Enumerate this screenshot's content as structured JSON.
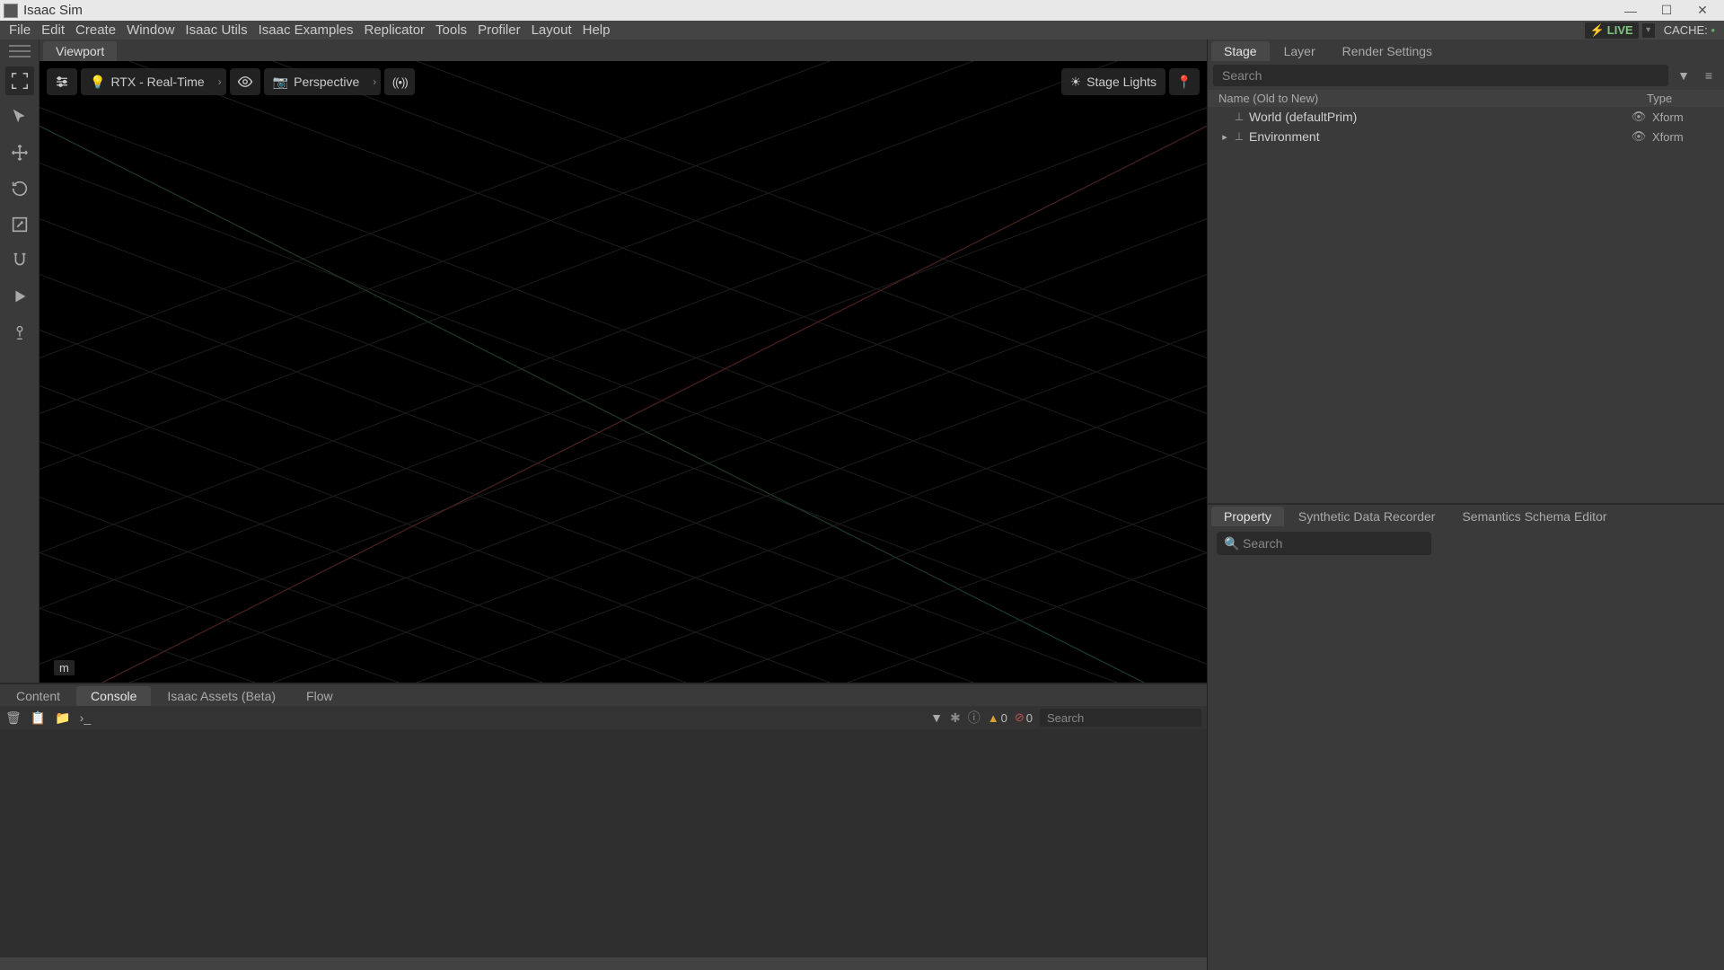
{
  "app_title": "Isaac Sim",
  "menus": [
    "File",
    "Edit",
    "Create",
    "Window",
    "Isaac Utils",
    "Isaac Examples",
    "Replicator",
    "Tools",
    "Profiler",
    "Layout",
    "Help"
  ],
  "live_label": "LIVE",
  "cache_label": "CACHE:",
  "viewport": {
    "tab": "Viewport",
    "render_mode": "RTX - Real-Time",
    "camera_label": "Perspective",
    "right_label": "Stage Lights",
    "corner_unit": "m"
  },
  "bottom_tabs": [
    "Content",
    "Console",
    "Isaac Assets (Beta)",
    "Flow"
  ],
  "bottom_active": 1,
  "console": {
    "warn_count": "0",
    "err_count": "0",
    "search_placeholder": "Search"
  },
  "right_top_tabs": [
    "Stage",
    "Layer",
    "Render Settings"
  ],
  "stage": {
    "search_placeholder": "Search",
    "header_name": "Name (Old to New)",
    "header_type": "Type",
    "rows": [
      {
        "expander": "",
        "label": "World (defaultPrim)",
        "type": "Xform",
        "indent": 0
      },
      {
        "expander": "▸",
        "label": "Environment",
        "type": "Xform",
        "indent": 0
      }
    ]
  },
  "right_bottom_tabs": [
    "Property",
    "Synthetic Data Recorder",
    "Semantics Schema Editor"
  ],
  "property": {
    "search_placeholder": "Search"
  }
}
